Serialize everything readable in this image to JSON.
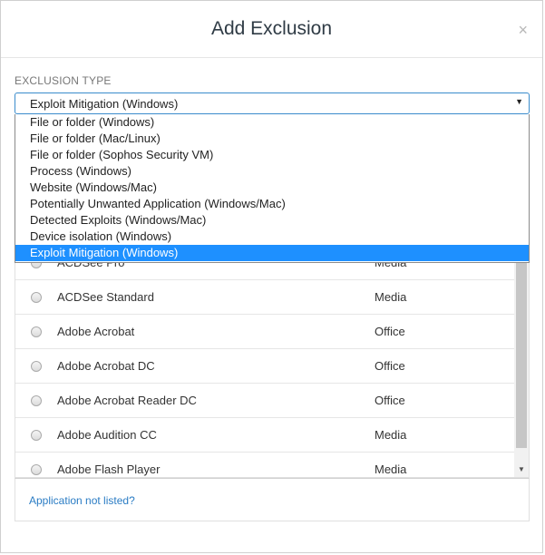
{
  "dialog": {
    "title": "Add Exclusion",
    "close_label": "×"
  },
  "exclusion_type": {
    "label": "EXCLUSION TYPE",
    "selected": "Exploit Mitigation (Windows)",
    "options": [
      "File or folder (Windows)",
      "File or folder (Mac/Linux)",
      "File or folder (Sophos Security VM)",
      "Process (Windows)",
      "Website (Windows/Mac)",
      "Potentially Unwanted Application (Windows/Mac)",
      "Detected Exploits (Windows/Mac)",
      "Device isolation (Windows)",
      "Exploit Mitigation (Windows)"
    ],
    "selected_index": 8
  },
  "applications": [
    {
      "name": "ACDSee Pro",
      "type": "Media"
    },
    {
      "name": "ACDSee Standard",
      "type": "Media"
    },
    {
      "name": "Adobe Acrobat",
      "type": "Office"
    },
    {
      "name": "Adobe Acrobat DC",
      "type": "Office"
    },
    {
      "name": "Adobe Acrobat Reader DC",
      "type": "Office"
    },
    {
      "name": "Adobe Audition CC",
      "type": "Media"
    },
    {
      "name": "Adobe Flash Player",
      "type": "Media"
    }
  ],
  "footer": {
    "link_label": "Application not listed?"
  }
}
